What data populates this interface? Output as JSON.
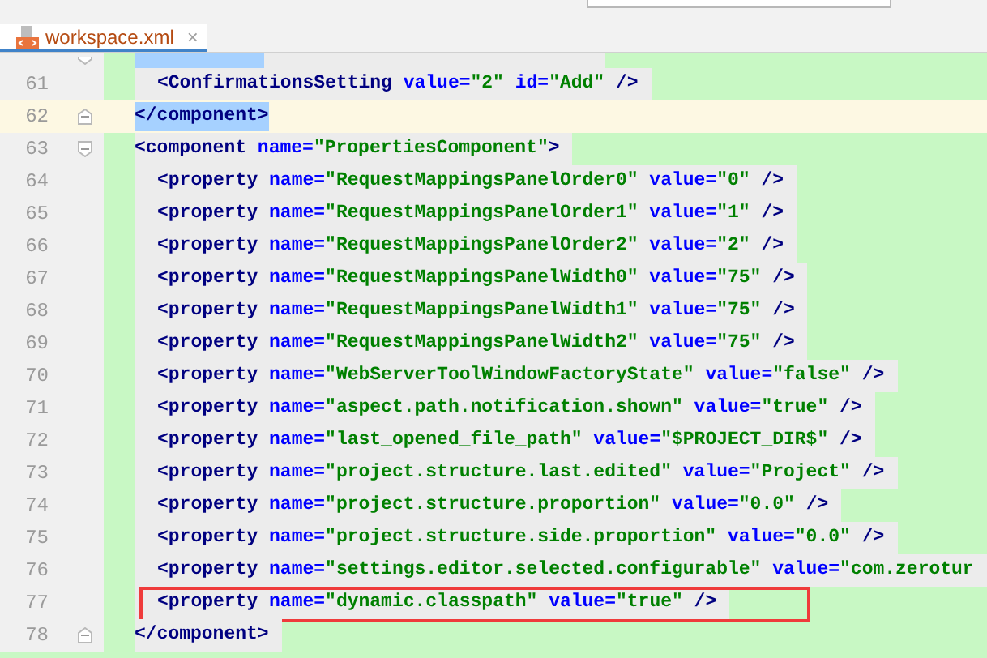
{
  "tab": {
    "title": "workspace.xml",
    "selected": true,
    "close": "×"
  },
  "lines": [
    {
      "kind": "cut",
      "current": false,
      "children": [
        {
          "kind": "plain",
          "number": "61",
          "current": false,
          "boxed": false,
          "tokens": [
            {
              "kind": "tag",
              "text": "<ConfirmationsSetting"
            },
            {
              "kind": "attr",
              "text": " value="
            },
            {
              "kind": "value",
              "text": "\"2\""
            },
            {
              "kind": "attr",
              "text": " id="
            },
            {
              "kind": "value",
              "text": "\"Add\""
            },
            {
              "kind": "tag",
              "text": " />"
            }
          ]
        }
      ]
    },
    {
      "kind": "close",
      "number": "62",
      "current": true,
      "boxed": false,
      "tokens": [
        {
          "kind": "tag-match",
          "text": "</component>"
        }
      ]
    },
    {
      "kind": "open",
      "number": "63",
      "current": false,
      "boxed": false,
      "tokens": [
        {
          "kind": "tag",
          "text": "<component"
        },
        {
          "kind": "attr",
          "text": " name="
        },
        {
          "kind": "value",
          "text": "\"PropertiesComponent\""
        },
        {
          "kind": "tag",
          "text": ">"
        }
      ],
      "children": [
        {
          "kind": "plain",
          "number": "64",
          "current": false,
          "boxed": false,
          "tokens": [
            {
              "kind": "tag",
              "text": "<property"
            },
            {
              "kind": "attr",
              "text": " name="
            },
            {
              "kind": "value",
              "text": "\"RequestMappingsPanelOrder0\""
            },
            {
              "kind": "attr",
              "text": " value="
            },
            {
              "kind": "value",
              "text": "\"0\""
            },
            {
              "kind": "tag",
              "text": " />"
            }
          ]
        },
        {
          "kind": "plain",
          "number": "65",
          "current": false,
          "boxed": false,
          "tokens": [
            {
              "kind": "tag",
              "text": "<property"
            },
            {
              "kind": "attr",
              "text": " name="
            },
            {
              "kind": "value",
              "text": "\"RequestMappingsPanelOrder1\""
            },
            {
              "kind": "attr",
              "text": " value="
            },
            {
              "kind": "value",
              "text": "\"1\""
            },
            {
              "kind": "tag",
              "text": " />"
            }
          ]
        },
        {
          "kind": "plain",
          "number": "66",
          "current": false,
          "boxed": false,
          "tokens": [
            {
              "kind": "tag",
              "text": "<property"
            },
            {
              "kind": "attr",
              "text": " name="
            },
            {
              "kind": "value",
              "text": "\"RequestMappingsPanelOrder2\""
            },
            {
              "kind": "attr",
              "text": " value="
            },
            {
              "kind": "value",
              "text": "\"2\""
            },
            {
              "kind": "tag",
              "text": " />"
            }
          ]
        },
        {
          "kind": "plain",
          "number": "67",
          "current": false,
          "boxed": false,
          "tokens": [
            {
              "kind": "tag",
              "text": "<property"
            },
            {
              "kind": "attr",
              "text": " name="
            },
            {
              "kind": "value",
              "text": "\"RequestMappingsPanelWidth0\""
            },
            {
              "kind": "attr",
              "text": " value="
            },
            {
              "kind": "value",
              "text": "\"75\""
            },
            {
              "kind": "tag",
              "text": " />"
            }
          ]
        },
        {
          "kind": "plain",
          "number": "68",
          "current": false,
          "boxed": false,
          "tokens": [
            {
              "kind": "tag",
              "text": "<property"
            },
            {
              "kind": "attr",
              "text": " name="
            },
            {
              "kind": "value",
              "text": "\"RequestMappingsPanelWidth1\""
            },
            {
              "kind": "attr",
              "text": " value="
            },
            {
              "kind": "value",
              "text": "\"75\""
            },
            {
              "kind": "tag",
              "text": " />"
            }
          ]
        },
        {
          "kind": "plain",
          "number": "69",
          "current": false,
          "boxed": false,
          "tokens": [
            {
              "kind": "tag",
              "text": "<property"
            },
            {
              "kind": "attr",
              "text": " name="
            },
            {
              "kind": "value",
              "text": "\"RequestMappingsPanelWidth2\""
            },
            {
              "kind": "attr",
              "text": " value="
            },
            {
              "kind": "value",
              "text": "\"75\""
            },
            {
              "kind": "tag",
              "text": " />"
            }
          ]
        },
        {
          "kind": "plain",
          "number": "70",
          "current": false,
          "boxed": false,
          "tokens": [
            {
              "kind": "tag",
              "text": "<property"
            },
            {
              "kind": "attr",
              "text": " name="
            },
            {
              "kind": "value",
              "text": "\"WebServerToolWindowFactoryState\""
            },
            {
              "kind": "attr",
              "text": " value="
            },
            {
              "kind": "value",
              "text": "\"false\""
            },
            {
              "kind": "tag",
              "text": " />"
            }
          ]
        },
        {
          "kind": "plain",
          "number": "71",
          "current": false,
          "boxed": false,
          "tokens": [
            {
              "kind": "tag",
              "text": "<property"
            },
            {
              "kind": "attr",
              "text": " name="
            },
            {
              "kind": "value",
              "text": "\"aspect.path.notification.shown\""
            },
            {
              "kind": "attr",
              "text": " value="
            },
            {
              "kind": "value",
              "text": "\"true\""
            },
            {
              "kind": "tag",
              "text": " />"
            }
          ]
        },
        {
          "kind": "plain",
          "number": "72",
          "current": false,
          "boxed": false,
          "tokens": [
            {
              "kind": "tag",
              "text": "<property"
            },
            {
              "kind": "attr",
              "text": " name="
            },
            {
              "kind": "value",
              "text": "\"last_opened_file_path\""
            },
            {
              "kind": "attr",
              "text": " value="
            },
            {
              "kind": "value",
              "text": "\"$PROJECT_DIR$\""
            },
            {
              "kind": "tag",
              "text": " />"
            }
          ]
        },
        {
          "kind": "plain",
          "number": "73",
          "current": false,
          "boxed": false,
          "tokens": [
            {
              "kind": "tag",
              "text": "<property"
            },
            {
              "kind": "attr",
              "text": " name="
            },
            {
              "kind": "value",
              "text": "\"project.structure.last.edited\""
            },
            {
              "kind": "attr",
              "text": " value="
            },
            {
              "kind": "value",
              "text": "\"Project\""
            },
            {
              "kind": "tag",
              "text": " />"
            }
          ]
        },
        {
          "kind": "plain",
          "number": "74",
          "current": false,
          "boxed": false,
          "tokens": [
            {
              "kind": "tag",
              "text": "<property"
            },
            {
              "kind": "attr",
              "text": " name="
            },
            {
              "kind": "value",
              "text": "\"project.structure.proportion\""
            },
            {
              "kind": "attr",
              "text": " value="
            },
            {
              "kind": "value",
              "text": "\"0.0\""
            },
            {
              "kind": "tag",
              "text": " />"
            }
          ]
        },
        {
          "kind": "plain",
          "number": "75",
          "current": false,
          "boxed": false,
          "tokens": [
            {
              "kind": "tag",
              "text": "<property"
            },
            {
              "kind": "attr",
              "text": " name="
            },
            {
              "kind": "value",
              "text": "\"project.structure.side.proportion\""
            },
            {
              "kind": "attr",
              "text": " value="
            },
            {
              "kind": "value",
              "text": "\"0.0\""
            },
            {
              "kind": "tag",
              "text": " />"
            }
          ]
        },
        {
          "kind": "plain",
          "number": "76",
          "current": false,
          "boxed": false,
          "tokens": [
            {
              "kind": "tag",
              "text": "<property"
            },
            {
              "kind": "attr",
              "text": " name="
            },
            {
              "kind": "value",
              "text": "\"settings.editor.selected.configurable\""
            },
            {
              "kind": "attr",
              "text": " value="
            },
            {
              "kind": "value",
              "text": "\"com.zerotur"
            }
          ]
        },
        {
          "kind": "plain",
          "number": "77",
          "current": false,
          "boxed": true,
          "tokens": [
            {
              "kind": "tag",
              "text": "<property"
            },
            {
              "kind": "attr",
              "text": " name="
            },
            {
              "kind": "value",
              "text": "\"dynamic.classpath\""
            },
            {
              "kind": "attr",
              "text": " value="
            },
            {
              "kind": "value",
              "text": "\"true\""
            },
            {
              "kind": "tag",
              "text": " />"
            }
          ]
        }
      ]
    },
    {
      "kind": "close",
      "number": "78",
      "current": false,
      "boxed": false,
      "tokens": [
        {
          "kind": "tag",
          "text": "</component>"
        }
      ]
    }
  ]
}
